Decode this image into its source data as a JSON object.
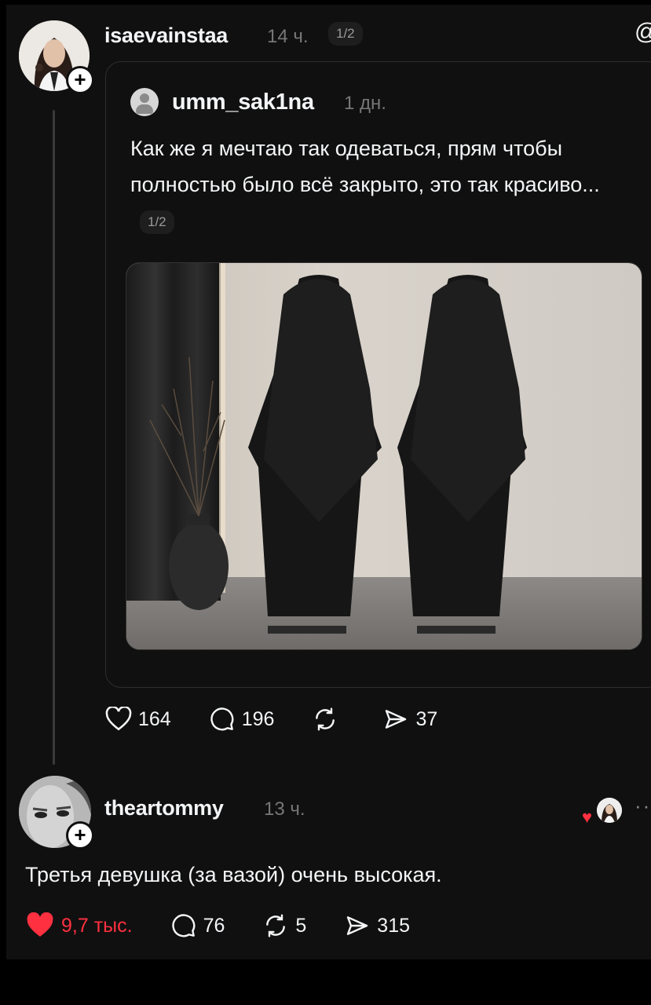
{
  "post": {
    "username": "isaevainstaa",
    "time": "14 ч.",
    "pager": "1/2",
    "corner_icon": "threads-icon"
  },
  "quoted": {
    "username": "umm_sak1na",
    "time": "1 дн.",
    "text": "Как же я мечтаю так одеваться, прям чтобы полностью было всё закрыто, это так красиво...",
    "pager": "1/2"
  },
  "post_actions": {
    "likes": "164",
    "comments": "196",
    "shares": "37"
  },
  "reply": {
    "username": "theartommy",
    "time": "13 ч.",
    "text": "Третья девушка (за вазой) очень высокая.",
    "dots": "···"
  },
  "reply_actions": {
    "likes": "9,7 тыс.",
    "comments": "76",
    "reposts": "5",
    "shares": "315"
  },
  "colors": {
    "background": "#101010",
    "like_red": "#ff3040",
    "muted_text": "#777777"
  }
}
